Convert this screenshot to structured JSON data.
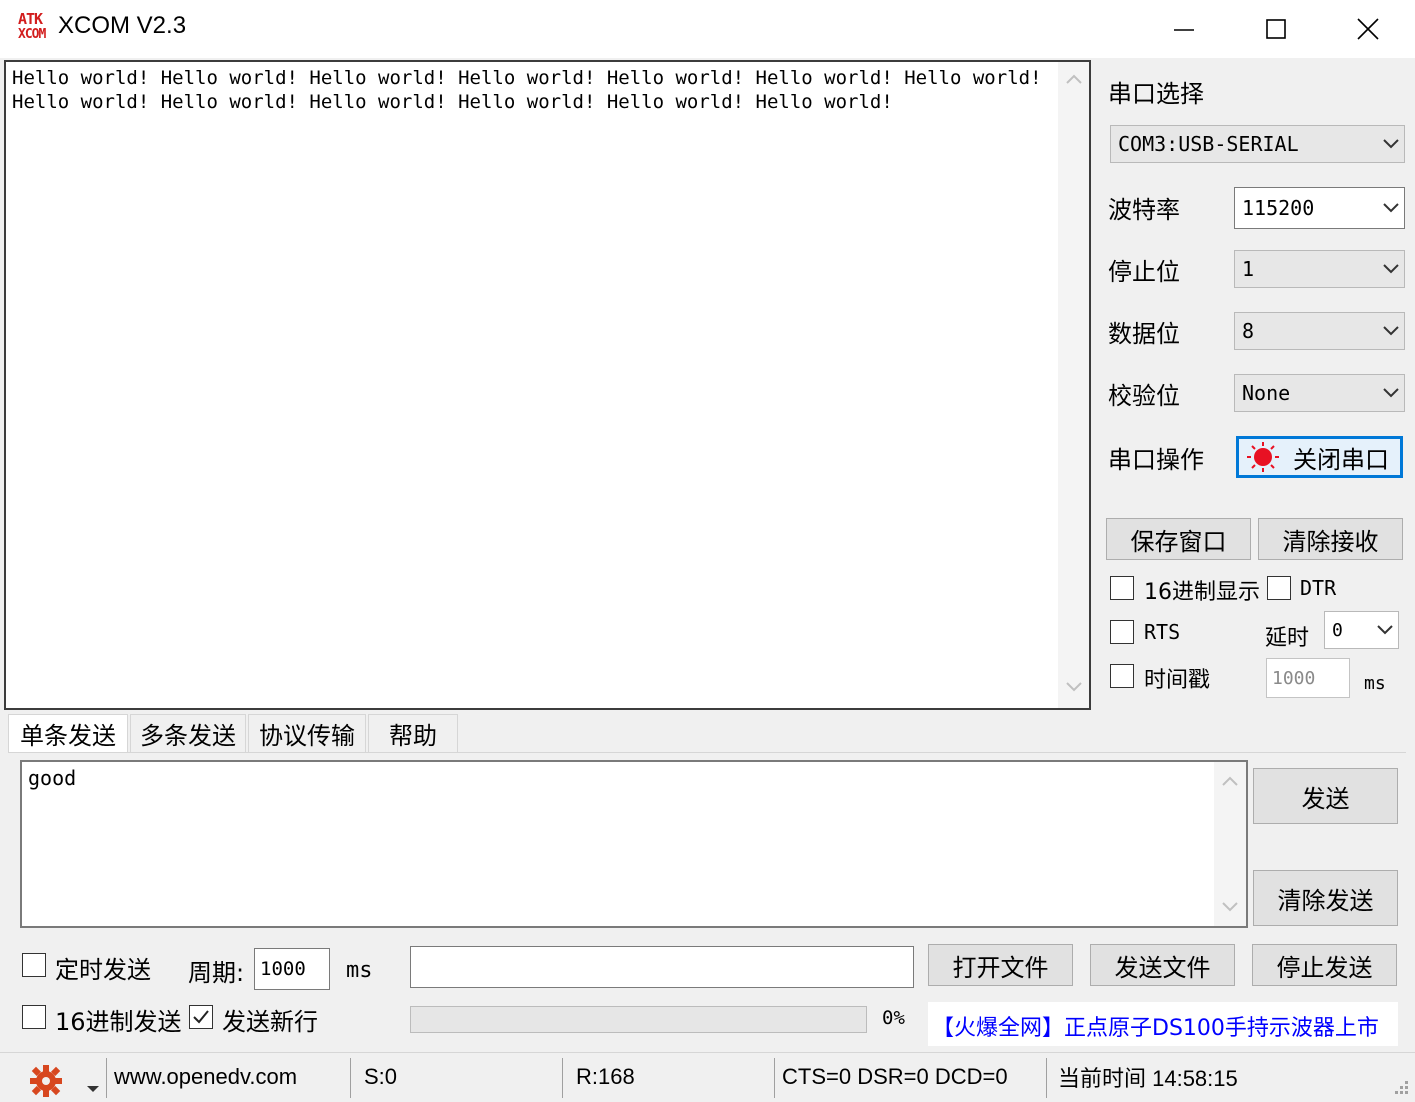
{
  "window": {
    "logo_line1": "ATK",
    "logo_line2": "XCOM",
    "title": "XCOM V2.3",
    "minimize_icon": "minimize-icon",
    "maximize_icon": "maximize-icon",
    "close_icon": "close-icon"
  },
  "receive": {
    "text": "Hello world! Hello world! Hello world! Hello world! Hello world! Hello world! Hello world! Hello world! Hello world! Hello world! Hello world! Hello world! Hello world!"
  },
  "settings": {
    "port_label": "串口选择",
    "port_value": "COM3:USB-SERIAL",
    "baud_label": "波特率",
    "baud_value": "115200",
    "stopbits_label": "停止位",
    "stopbits_value": "1",
    "databits_label": "数据位",
    "databits_value": "8",
    "parity_label": "校验位",
    "parity_value": "None",
    "operation_label": "串口操作",
    "close_port_label": "关闭串口",
    "status_color": "#e81123"
  },
  "actions": {
    "save_window": "保存窗口",
    "clear_receive": "清除接收"
  },
  "options": {
    "hex_display": "16进制显示",
    "dtr": "DTR",
    "rts": "RTS",
    "delay_label": "延时",
    "delay_value": "0",
    "timestamp": "时间戳",
    "timestamp_value": "1000",
    "timestamp_unit": "ms"
  },
  "tabs": [
    "单条发送",
    "多条发送",
    "协议传输",
    "帮助"
  ],
  "send": {
    "text": "good",
    "send_button": "发送",
    "clear_send_button": "清除发送",
    "timed_send": "定时发送",
    "period_label": "周期:",
    "period_value": "1000",
    "period_unit": "ms",
    "file_path": "",
    "open_file": "打开文件",
    "send_file": "发送文件",
    "stop_send": "停止发送",
    "hex_send": "16进制发送",
    "send_newline": "发送新行",
    "progress_percent": 0,
    "progress_label": "0%",
    "ad_text": "【火爆全网】正点原子DS100手持示波器上市",
    "ad_color": "#0000ff"
  },
  "status": {
    "settings_icon": "gear-icon",
    "website": "www.openedv.com",
    "sent": "S:0",
    "received": "R:168",
    "lines": "CTS=0 DSR=0 DCD=0",
    "time": "当前时间 14:58:15"
  }
}
